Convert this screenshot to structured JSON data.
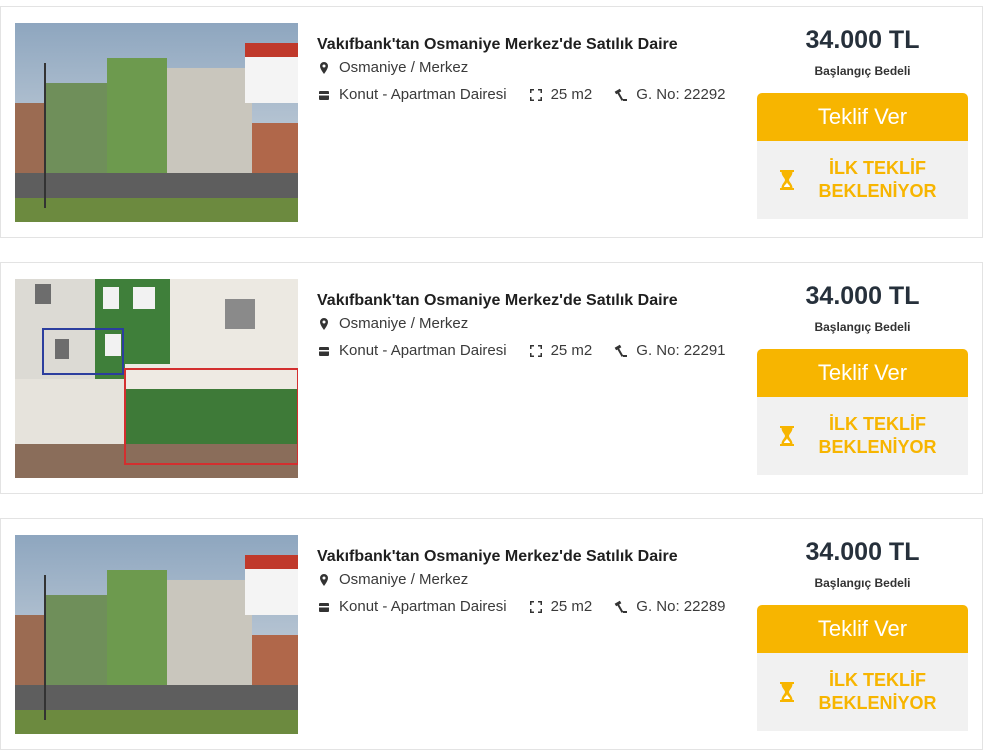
{
  "colors": {
    "accent": "#f7b500",
    "price": "#26303b",
    "panel": "#f1f1f1"
  },
  "listings": [
    {
      "title": "Vakıfbank'tan Osmaniye Merkez'de Satılık Daire",
      "location_icon": "map-pin-icon",
      "location": "Osmaniye / Merkez",
      "category_icon": "building-icon",
      "category": "Konut - Apartman Dairesi",
      "area_icon": "area-icon",
      "area": "25 m2",
      "gno_icon": "hammer-icon",
      "gno": "G. No: 22292",
      "price": "34.000 TL",
      "price_label": "Başlangıç Bedeli",
      "offer_button": "Teklif Ver",
      "status_icon": "hourglass-icon",
      "status_line1": "İLK TEKLİF",
      "status_line2": "BEKLENİYOR"
    },
    {
      "title": "Vakıfbank'tan Osmaniye Merkez'de Satılık Daire",
      "location_icon": "map-pin-icon",
      "location": "Osmaniye / Merkez",
      "category_icon": "building-icon",
      "category": "Konut - Apartman Dairesi",
      "area_icon": "area-icon",
      "area": "25 m2",
      "gno_icon": "hammer-icon",
      "gno": "G. No: 22291",
      "price": "34.000 TL",
      "price_label": "Başlangıç Bedeli",
      "offer_button": "Teklif Ver",
      "status_icon": "hourglass-icon",
      "status_line1": "İLK TEKLİF",
      "status_line2": "BEKLENİYOR"
    },
    {
      "title": "Vakıfbank'tan Osmaniye Merkez'de Satılık Daire",
      "location_icon": "map-pin-icon",
      "location": "Osmaniye / Merkez",
      "category_icon": "building-icon",
      "category": "Konut - Apartman Dairesi",
      "area_icon": "area-icon",
      "area": "25 m2",
      "gno_icon": "hammer-icon",
      "gno": "G. No: 22289",
      "price": "34.000 TL",
      "price_label": "Başlangıç Bedeli",
      "offer_button": "Teklif Ver",
      "status_icon": "hourglass-icon",
      "status_line1": "İLK TEKLİF",
      "status_line2": "BEKLENİYOR"
    }
  ]
}
